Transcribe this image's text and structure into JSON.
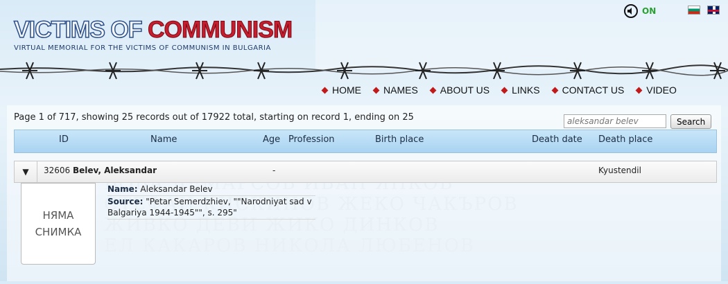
{
  "header": {
    "logo_part1": "VICTIMS OF ",
    "logo_part2": "COMMUNISM",
    "subtitle": "VIRTUAL MEMORIAL FOR THE VICTIMS OF COMMUNISM IN BULGARIA",
    "sound_label": "ON",
    "flags": [
      "bg-flag-icon",
      "uk-flag-icon"
    ]
  },
  "nav": {
    "items": [
      {
        "label": "HOME"
      },
      {
        "label": "NAMES"
      },
      {
        "label": "ABOUT US"
      },
      {
        "label": "LINKS"
      },
      {
        "label": "CONTACT US"
      },
      {
        "label": "VIDEO"
      }
    ]
  },
  "listing": {
    "summary": "Page 1 of 717, showing 25 records out of 17922 total, starting on record 1, ending on 25",
    "search_value": "aleksandar belev",
    "search_button": "Search"
  },
  "table": {
    "columns": [
      "ID",
      "Name",
      "Age",
      "Profession",
      "Birth place",
      "Death date",
      "Death place"
    ],
    "row": {
      "id": "32606",
      "name": "Belev, Aleksandar",
      "age": "-",
      "profession": "",
      "birth_place": "",
      "death_date": "",
      "death_place": "Kyustendil"
    }
  },
  "detail": {
    "photo_line1": "НЯМА",
    "photo_line2": "СНИМКА",
    "name_label": "Name:",
    "name_value": "Aleksandar Belev",
    "source_label": "Source:",
    "source_value": "\"Petar Semerdzhiev, \"\"Narodniyat sad v Balgariya 1944-1945\"\", s. 295\""
  },
  "colors": {
    "accent_red": "#c51e2e",
    "header_blue": "#a9d3f1",
    "sound_on_green": "#2aa032"
  }
}
